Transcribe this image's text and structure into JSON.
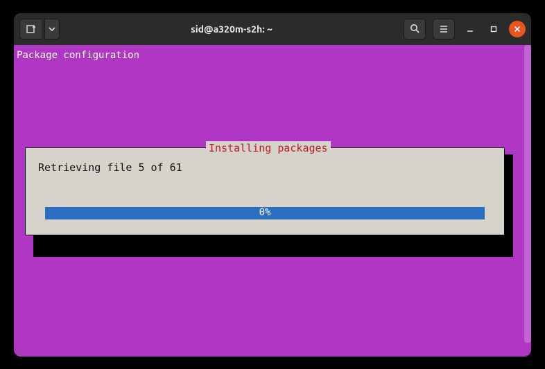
{
  "titlebar": {
    "title": "sid@a320m-s2h: ~"
  },
  "terminal": {
    "header": "Package configuration"
  },
  "dialog": {
    "title": "Installing packages",
    "message": "Retrieving file 5 of 61",
    "progress_label": "0%",
    "progress_value": 0,
    "total_files": 61,
    "current_file": 5
  }
}
